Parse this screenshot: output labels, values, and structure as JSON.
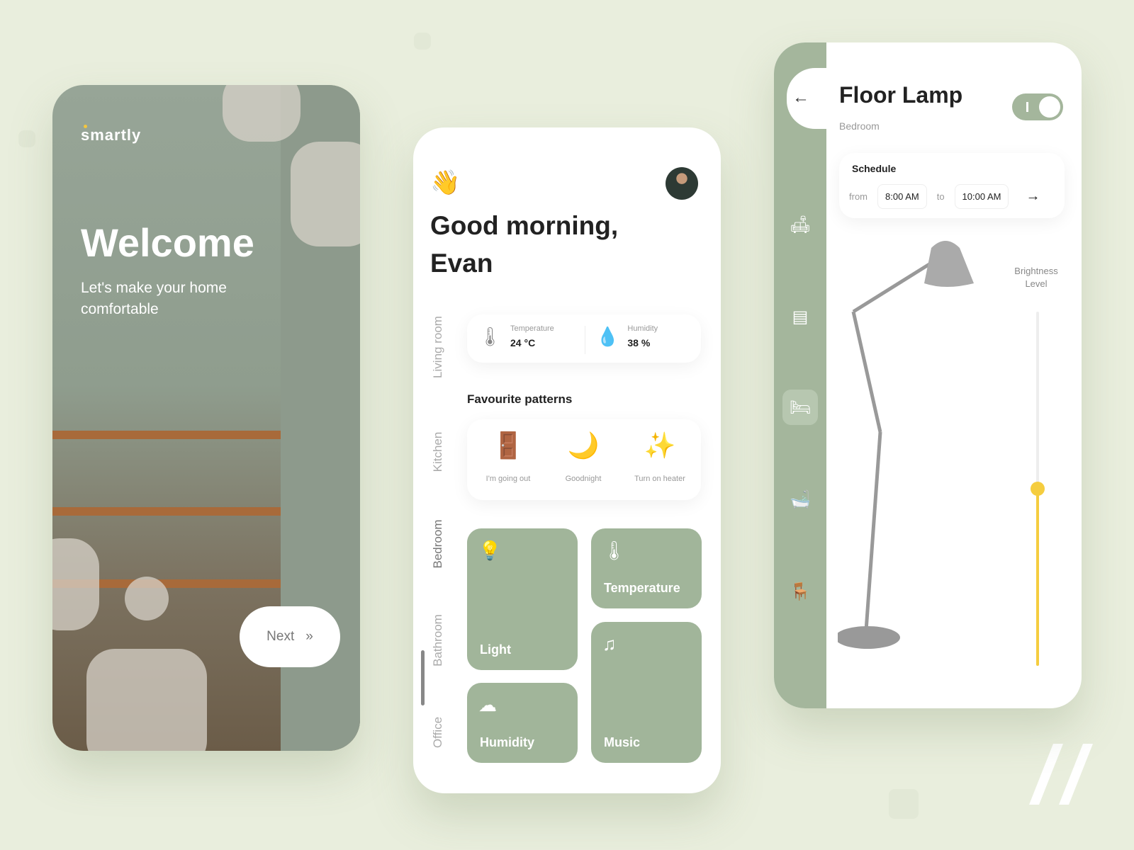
{
  "welcome": {
    "logo": "smartly",
    "title": "Welcome",
    "subtitle": "Let's make your home comfortable",
    "next_label": "Next"
  },
  "home": {
    "wave_emoji": "👋",
    "greeting": "Good morning, Evan",
    "rooms": [
      "Living room",
      "Kitchen",
      "Bedroom",
      "Bathroom",
      "Office"
    ],
    "active_room": "Bedroom",
    "stats": [
      {
        "label": "Temperature",
        "value": "24 °C",
        "icon": "thermometer-sun-icon"
      },
      {
        "label": "Humidity",
        "value": "38 %",
        "icon": "droplets-icon"
      }
    ],
    "favourites_title": "Favourite patterns",
    "patterns": [
      {
        "emoji": "🚪",
        "label": "I'm going out"
      },
      {
        "emoji": "🌙",
        "label": "Goodnight"
      },
      {
        "emoji": "✨",
        "label": "Turn on heater"
      }
    ],
    "tiles": [
      {
        "label": "Light",
        "icon": "bulb-icon"
      },
      {
        "label": "Temperature",
        "icon": "thermometer-icon"
      },
      {
        "label": "Humidity",
        "icon": "cloud-rain-icon"
      },
      {
        "label": "Music",
        "icon": "music-icon"
      }
    ]
  },
  "lamp": {
    "title": "Floor Lamp",
    "room": "Bedroom",
    "power_on": true,
    "schedule_title": "Schedule",
    "from_label": "from",
    "from": "8:00 AM",
    "to_label": "to",
    "to": "10:00 AM",
    "brightness_label": "Brightness Level",
    "brightness": 0.5,
    "nav": [
      "sofa-icon",
      "oven-icon",
      "bed-icon",
      "bathtub-icon",
      "office-chair-icon"
    ],
    "active_nav": "bed-icon"
  },
  "colors": {
    "accent": "#a1b59a",
    "brightness": "#f5cd3f"
  }
}
